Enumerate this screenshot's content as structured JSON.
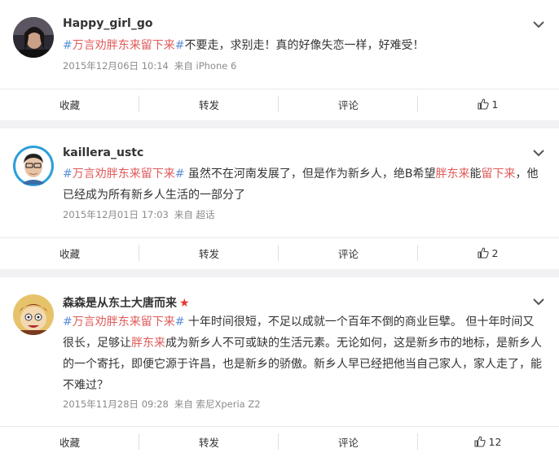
{
  "posts": [
    {
      "username": "Happy_girl_go",
      "verified_star": false,
      "text_segments": [
        {
          "type": "hashtag",
          "text": "#"
        },
        {
          "type": "tag",
          "text": "万言劝胖东来留下来"
        },
        {
          "type": "hashtag",
          "text": "#"
        },
        {
          "type": "plain",
          "text": "不要走，求别走！真的好像失恋一样，好难受！"
        }
      ],
      "date": "2015年12月06日 10:14",
      "source": "来自 iPhone 6",
      "actions": {
        "collect": "收藏",
        "repost": "转发",
        "comment": "评论",
        "likes": "1"
      }
    },
    {
      "username": "kaillera_ustc",
      "verified_star": false,
      "text_segments": [
        {
          "type": "hashtag",
          "text": "#"
        },
        {
          "type": "tag",
          "text": "万言劝胖东来留下来"
        },
        {
          "type": "hashtag",
          "text": "#"
        },
        {
          "type": "plain",
          "text": " 虽然不在河南发展了，但是作为新乡人，绝B希望"
        },
        {
          "type": "hl",
          "text": "胖东来"
        },
        {
          "type": "plain",
          "text": "能"
        },
        {
          "type": "hl",
          "text": "留下来"
        },
        {
          "type": "plain",
          "text": "，他已经成为所有新乡人生活的一部分了"
        }
      ],
      "date": "2015年12月01日 17:03",
      "source": "来自 超话",
      "actions": {
        "collect": "收藏",
        "repost": "转发",
        "comment": "评论",
        "likes": "2"
      }
    },
    {
      "username": "森森是从东土大唐而来",
      "verified_star": true,
      "star_glyph": "★",
      "text_segments": [
        {
          "type": "hashtag",
          "text": "#"
        },
        {
          "type": "tag",
          "text": "万言劝胖东来留下来"
        },
        {
          "type": "hashtag",
          "text": "#"
        },
        {
          "type": "plain",
          "text": " 十年时间很短，不足以成就一个百年不倒的商业巨擘。 但十年时间又很长，足够让"
        },
        {
          "type": "hl",
          "text": "胖东来"
        },
        {
          "type": "plain",
          "text": "成为新乡人不可或缺的生活元素。无论如何，这是新乡市的地标，是新乡人的一个寄托，即便它源于许昌，也是新乡的骄傲。新乡人早已经把他当自己家人，家人走了，能不难过？"
        }
      ],
      "date": "2015年11月28日 09:28",
      "source": "来自 索尼Xperia Z2",
      "actions": {
        "collect": "收藏",
        "repost": "转发",
        "comment": "评论",
        "likes": "12"
      }
    }
  ],
  "icons": {
    "expand": "chevron-down-icon",
    "like": "thumbs-up-icon"
  },
  "colors": {
    "tag": "#e05a5a",
    "hashtag": "#5b8fd6",
    "meta": "#8b8b8b",
    "star": "#e8352c",
    "background": "#f2f2f5"
  }
}
